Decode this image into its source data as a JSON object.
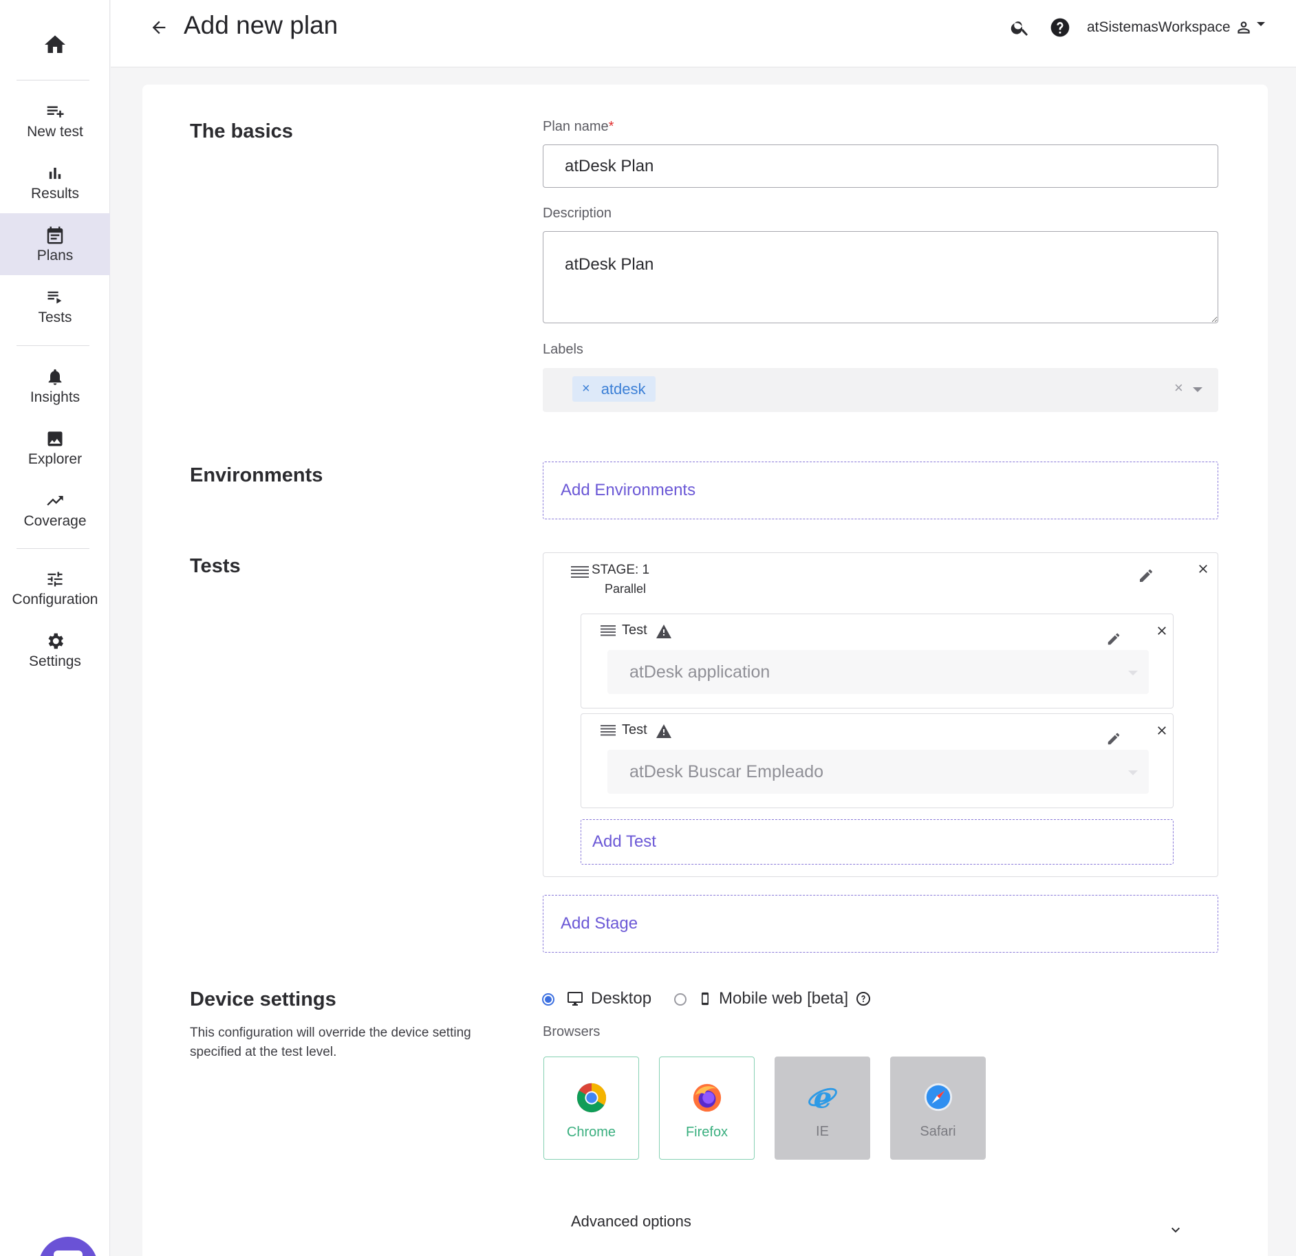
{
  "colors": {
    "accent": "#6b58d6",
    "active_nav": "#e4e3f1",
    "required": "#e02d2d",
    "chip_text": "#3b7fd6",
    "browser_enabled": "#3aaf7f"
  },
  "sidebar": {
    "items": [
      {
        "label": "New test",
        "icon": "playlist-add-icon"
      },
      {
        "label": "Results",
        "icon": "bar-chart-icon"
      },
      {
        "label": "Plans",
        "icon": "calendar-icon",
        "active": true
      },
      {
        "label": "Tests",
        "icon": "list-play-icon"
      },
      {
        "label": "Insights",
        "icon": "bell-icon"
      },
      {
        "label": "Explorer",
        "icon": "image-icon"
      },
      {
        "label": "Coverage",
        "icon": "trending-up-icon"
      },
      {
        "label": "Configuration",
        "icon": "tune-icon"
      },
      {
        "label": "Settings",
        "icon": "gear-icon"
      }
    ]
  },
  "header": {
    "title": "Add new plan",
    "workspace": "atSistemasWorkspace"
  },
  "basics": {
    "section_title": "The basics",
    "plan_name_label": "Plan name",
    "required_mark": "*",
    "plan_name_value": "atDesk Plan",
    "description_label": "Description",
    "description_value": "atDesk Plan",
    "labels_label": "Labels",
    "labels": [
      "atdesk"
    ],
    "chip_remove": "×",
    "clear_symbol": "×"
  },
  "environments": {
    "section_title": "Environments",
    "add_label": "Add Environments"
  },
  "tests": {
    "section_title": "Tests",
    "stage": {
      "title": "STAGE: 1",
      "mode": "Parallel",
      "items": [
        {
          "label": "Test",
          "value": "atDesk application"
        },
        {
          "label": "Test",
          "value": "atDesk Buscar Empleado"
        }
      ],
      "add_test_label": "Add Test"
    },
    "add_stage_label": "Add Stage"
  },
  "device": {
    "section_title": "Device settings",
    "description": "This configuration will override the device setting specified at the test level.",
    "options": [
      {
        "label": "Desktop",
        "selected": true
      },
      {
        "label": "Mobile web [beta]",
        "selected": false
      }
    ],
    "browsers_label": "Browsers",
    "browsers": [
      {
        "name": "Chrome",
        "enabled": true
      },
      {
        "name": "Firefox",
        "enabled": true
      },
      {
        "name": "IE",
        "enabled": false
      },
      {
        "name": "Safari",
        "enabled": false
      }
    ]
  },
  "advanced": {
    "label": "Advanced options"
  }
}
